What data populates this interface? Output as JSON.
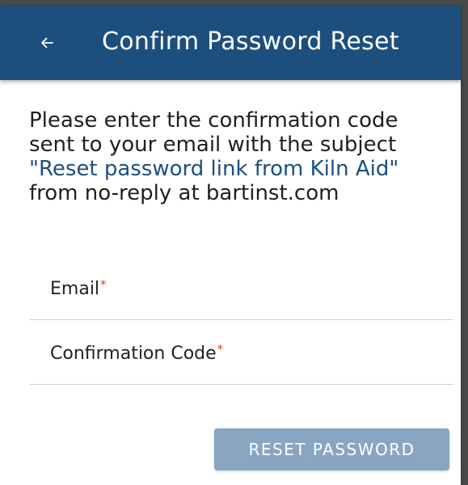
{
  "appbar": {
    "title": "Confirm Password Reset",
    "back_icon": "arrow-left-icon",
    "color": "#1d4f7e"
  },
  "intro": {
    "line1": "Please enter the confirmation code",
    "line2": "sent to your email with the subject",
    "subject": "\"Reset password link from Kiln Aid\"",
    "line4": "from no-reply at bartinst.com"
  },
  "form": {
    "email": {
      "label": "Email",
      "required_mark": "*",
      "value": ""
    },
    "code": {
      "label": "Confirmation Code",
      "required_mark": "*",
      "value": ""
    },
    "submit_label": "RESET PASSWORD",
    "submit_color": "#8aa5c2",
    "required_color": "#e0441b"
  }
}
